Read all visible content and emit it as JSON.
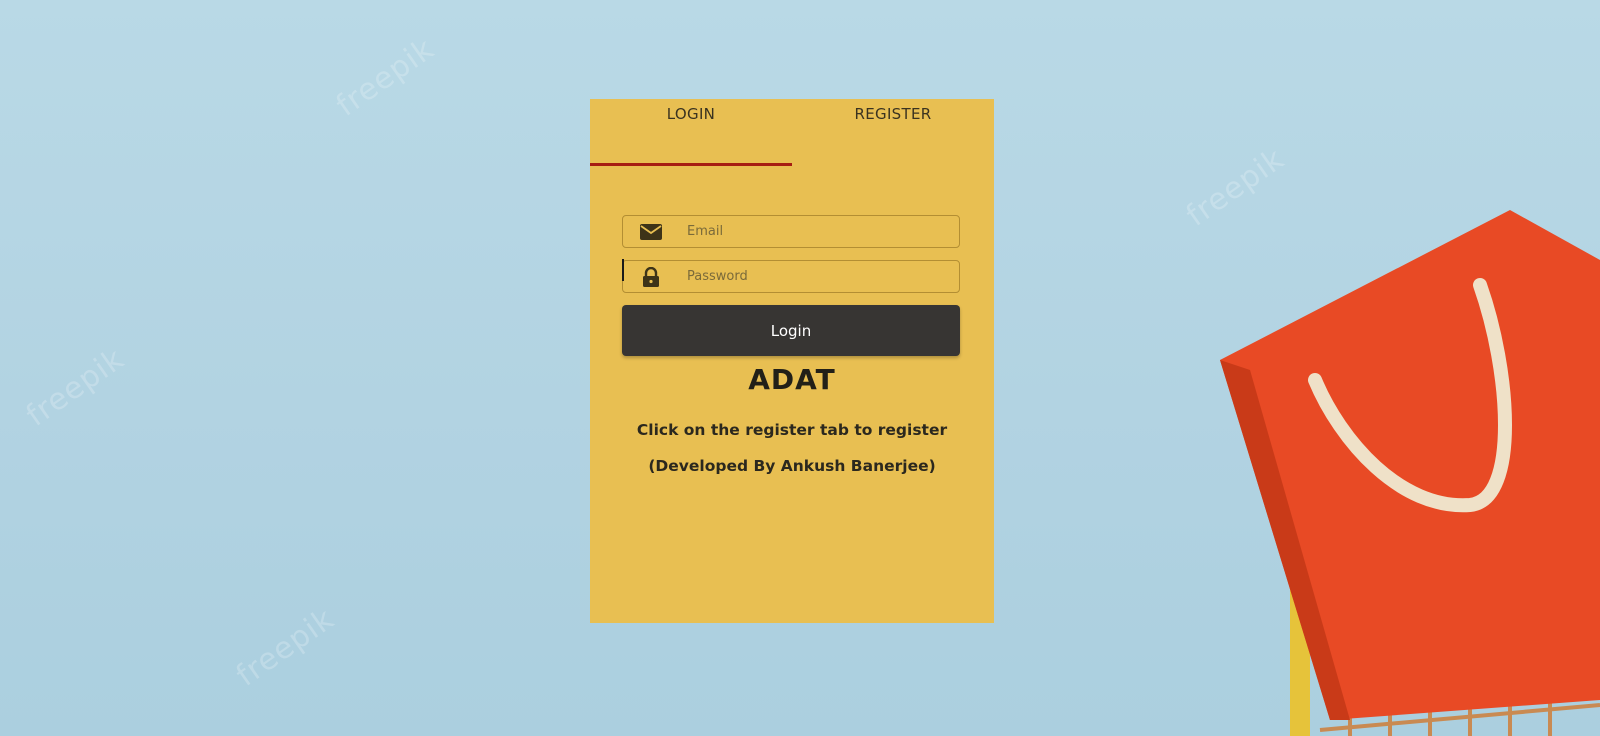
{
  "tabs": [
    {
      "label": "LOGIN",
      "active": true
    },
    {
      "label": "REGISTER",
      "active": false
    }
  ],
  "form": {
    "email": {
      "icon": "envelope-icon",
      "placeholder": "Email",
      "value": ""
    },
    "password": {
      "icon": "lock-icon",
      "placeholder": "Password",
      "value": ""
    },
    "submit_label": "Login"
  },
  "brand": "ADAT",
  "hint_text": "Click on the register tab to register",
  "credit_text": "(Developed By Ankush Banerjee)",
  "background": {
    "watermark_text": "freepik"
  },
  "colors": {
    "card": "#e8bf52",
    "tab_indicator": "#a61d12",
    "button": "#373533",
    "background": "#b4d5e3",
    "bag": "#e84a25"
  }
}
